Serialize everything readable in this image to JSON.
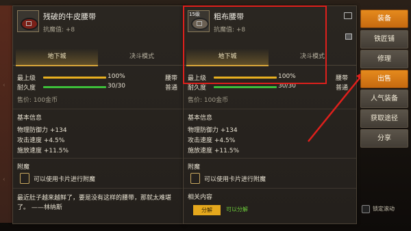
{
  "left": {
    "item_level": "",
    "item_name": "残破的牛皮腰带",
    "magic_resistance": "抗魔值: +8",
    "tabs": [
      "地下城",
      "决斗模式"
    ],
    "grade_label": "最上级",
    "grade_pct": "100%",
    "durability_label": "耐久度",
    "durability_value": "30/30",
    "side_label_1": "腰带",
    "side_label_2": "普通",
    "price": "售价: 100金币",
    "basic_info_title": "基本信息",
    "stats": [
      "物理防御力 +134",
      "攻击速度 +4.5%",
      "施放速度 +11.5%"
    ],
    "enchant_title": "附魔",
    "enchant_text": "可以使用卡片进行附魔",
    "flavor_text": "最近肚子越来越鲜了，要是没有这样的腰带，那就太难堪了。 ——林纳斯"
  },
  "right": {
    "item_level": "15级",
    "item_name": "粗布腰带",
    "magic_resistance": "抗魔值: +8",
    "tabs": [
      "地下城",
      "决斗模式"
    ],
    "grade_label": "最上级",
    "grade_pct": "100%",
    "durability_label": "耐久度",
    "durability_value": "30/30",
    "side_label_1": "腰带",
    "side_label_2": "普通",
    "price": "售价: 100金币",
    "basic_info_title": "基本信息",
    "stats": [
      "物理防御力 +134",
      "攻击速度 +4.5%",
      "施放速度 +11.5%"
    ],
    "enchant_title": "附魔",
    "enchant_text": "可以使用卡片进行附魔",
    "related_title": "相关内容",
    "disassemble_label": "分解",
    "disassemble_status": "可以分解"
  },
  "actions": [
    {
      "label": "装备",
      "style": "orange"
    },
    {
      "label": "铁匠铺",
      "style": "gray"
    },
    {
      "label": "修理",
      "style": "gray"
    },
    {
      "label": "出售",
      "style": "orange"
    },
    {
      "label": "人气装备",
      "style": "gray"
    },
    {
      "label": "获取途径",
      "style": "gray"
    },
    {
      "label": "分享",
      "style": "gray"
    }
  ],
  "lock_scroll_label": "锁定滚动",
  "colors": {
    "accent_orange": "#e58a1d",
    "highlight_red": "#e0201c",
    "grade_bar": "#e8b020",
    "durability_bar": "#3cc03a"
  },
  "grade_fraction": 1.0,
  "durability_fraction": 1.0
}
